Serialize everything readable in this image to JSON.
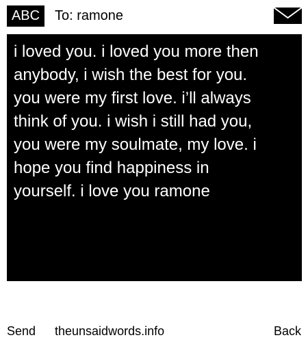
{
  "header": {
    "mode_label": "ABC",
    "recipient_label": "To: ramone",
    "envelope_icon": "envelope-icon"
  },
  "message": {
    "body": "i loved you. i loved you more then\nanybody, i wish the best for you.\nyou were my first love. i’ll always\nthink of you. i wish i still had you,\nyou were my soulmate, my love. i\nhope you find happiness in\nyourself. i love you ramone"
  },
  "footer": {
    "send_label": "Send",
    "site_label": "theunsaidwords.info",
    "back_label": "Back"
  },
  "colors": {
    "background": "#ffffff",
    "foreground": "#000000",
    "inverse_text": "#ffffff"
  }
}
